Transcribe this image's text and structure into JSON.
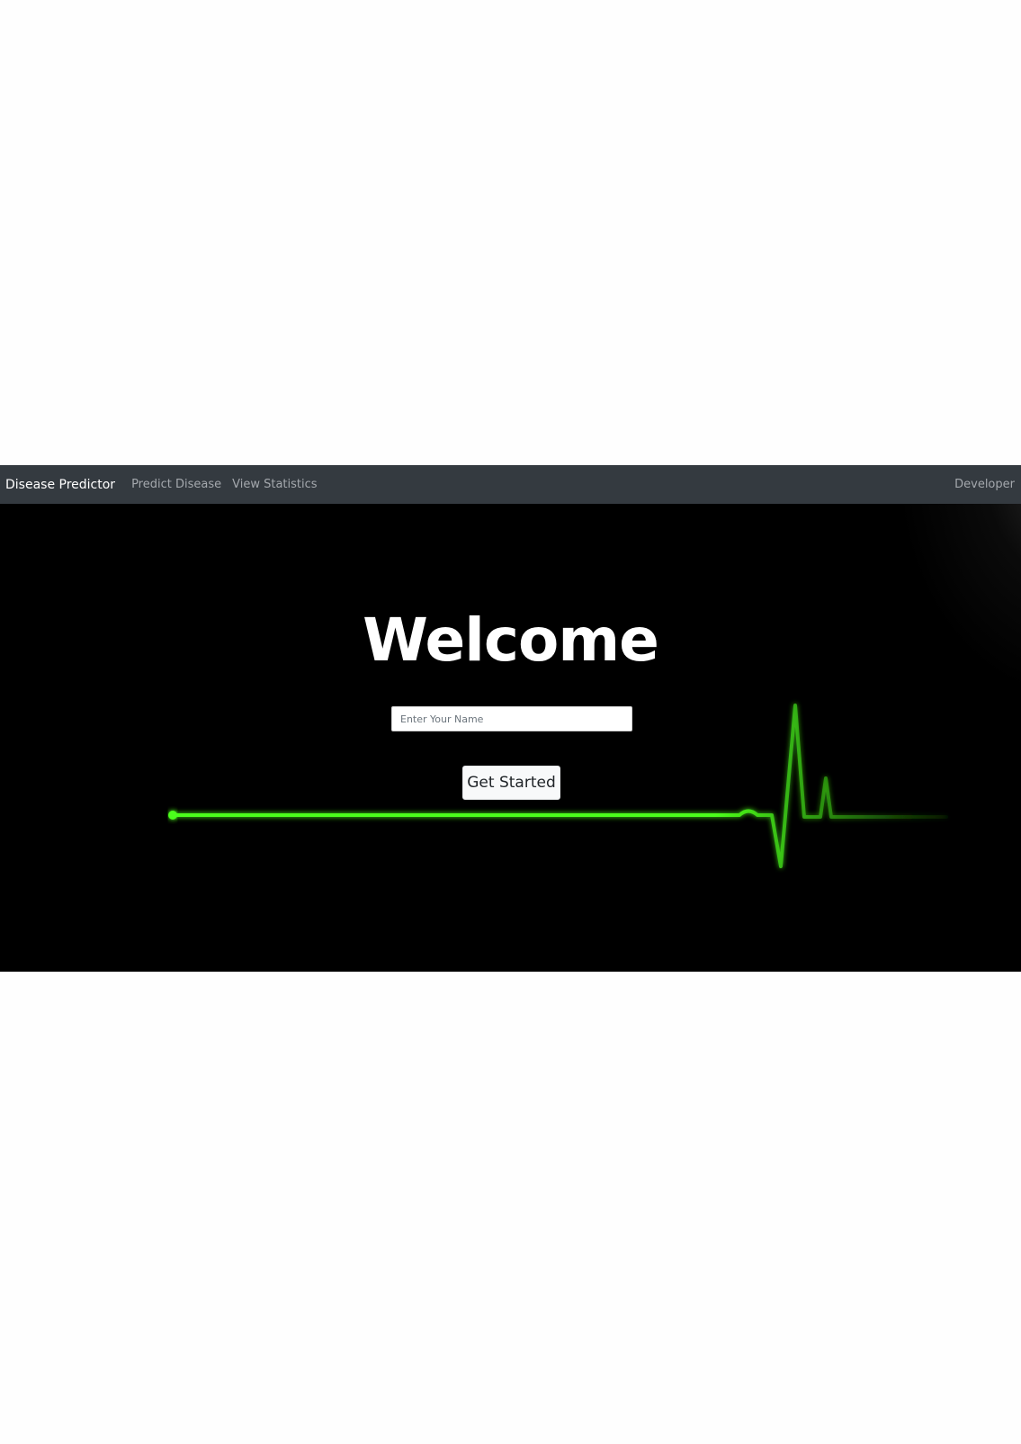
{
  "navbar": {
    "brand": "Disease Predictor",
    "links": [
      "Predict Disease",
      "View Statistics"
    ],
    "right_link": "Developer"
  },
  "hero": {
    "title": "Welcome",
    "name_input": {
      "placeholder": "Enter Your Name",
      "value": ""
    },
    "cta_label": "Get Started",
    "ecg_line_color": "#4cff1a"
  },
  "colors": {
    "navbar_bg": "#343a40",
    "hero_bg": "#000000",
    "nav_link": "#a4a8ad",
    "brand_text": "#ffffff"
  }
}
